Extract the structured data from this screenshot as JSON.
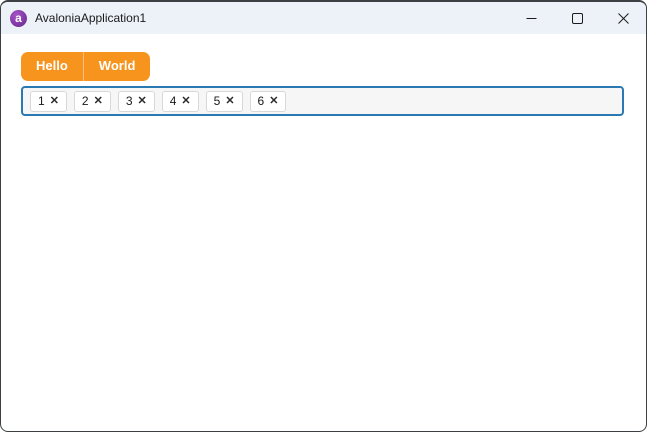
{
  "window": {
    "title": "AvaloniaApplication1",
    "logo_glyph": "a",
    "caption_buttons": {
      "minimize_label": "Minimize",
      "maximize_label": "Maximize",
      "close_label": "Close"
    }
  },
  "tabs": [
    {
      "label": "Hello"
    },
    {
      "label": "World"
    }
  ],
  "chip_input": {
    "remove_glyph": "✕",
    "chips": [
      {
        "label": "1"
      },
      {
        "label": "2"
      },
      {
        "label": "3"
      },
      {
        "label": "4"
      },
      {
        "label": "5"
      },
      {
        "label": "6"
      }
    ]
  },
  "colors": {
    "accent_orange": "#f7941e",
    "focus_border_blue": "#2b79b2",
    "titlebar_bg": "#edf2f8",
    "window_border": "#3c4043",
    "logo_purple": "#8b3fae",
    "chip_border": "#d8d8d8",
    "chipbox_bg": "#f6f6f6"
  }
}
